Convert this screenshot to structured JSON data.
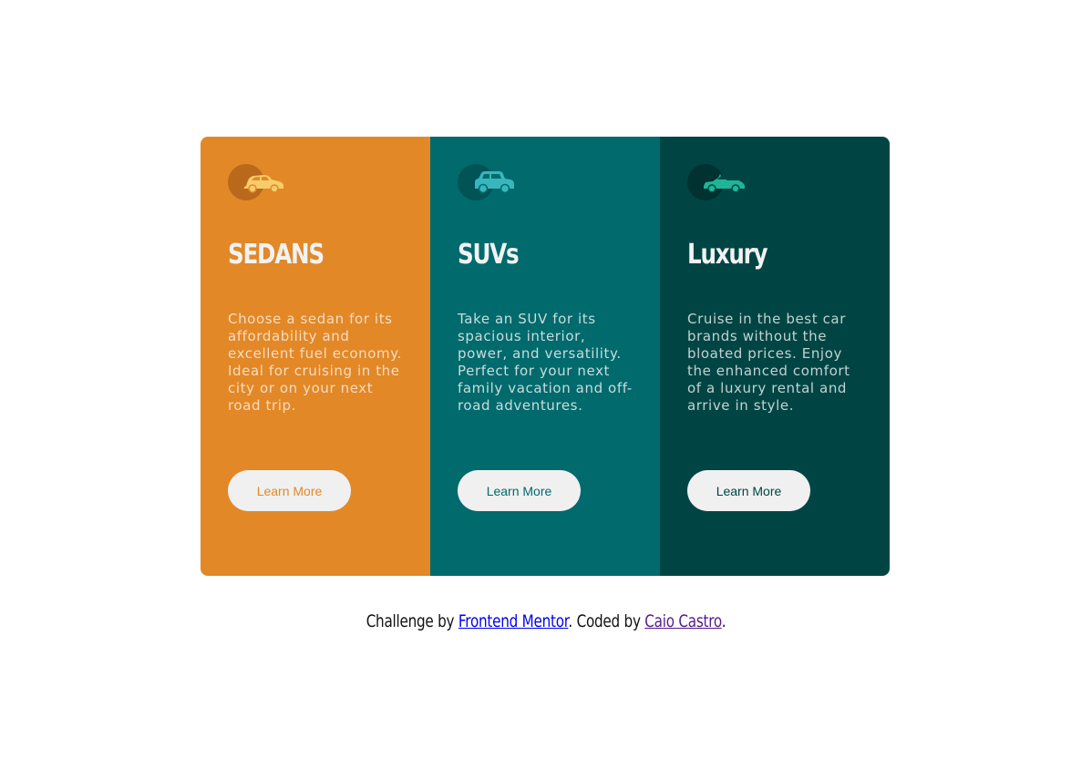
{
  "cards": [
    {
      "icon": "sedan-car-icon",
      "title": "SEDANS",
      "text": "Choose a sedan for its affordability and excellent fuel economy. Ideal for cruising in the city or on your next road trip.",
      "button_label": "Learn More",
      "color": "#e28827"
    },
    {
      "icon": "suv-car-icon",
      "title": "SUVs",
      "text": "Take an SUV for its spacious interior, power, and versatility. Perfect for your next family vacation and off-road adventures.",
      "button_label": "Learn More",
      "color": "#006a6c"
    },
    {
      "icon": "luxury-car-icon",
      "title": "Luxury",
      "text": "Cruise in the best car brands without the bloated prices. Enjoy the enhanced comfort of a luxury rental and arrive in style.",
      "button_label": "Learn More",
      "color": "#004544"
    }
  ],
  "attribution": {
    "prefix": "Challenge by ",
    "link1": "Frontend Mentor",
    "middle": ". Coded by ",
    "link2": "Caio Castro",
    "suffix": "."
  }
}
